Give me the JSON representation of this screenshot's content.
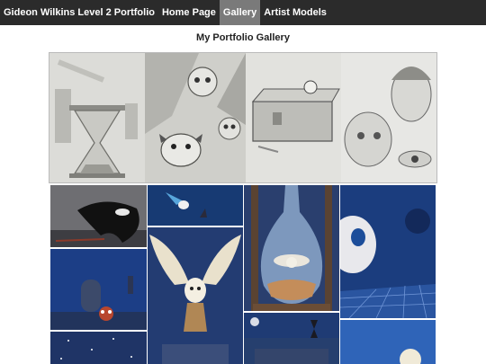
{
  "nav": {
    "brand": "Gideon Wilkins Level 2 Portfolio",
    "items": [
      {
        "label": "Home Page",
        "active": false
      },
      {
        "label": "Gallery",
        "active": true
      },
      {
        "label": "Artist Models",
        "active": false
      }
    ]
  },
  "main": {
    "title": "My Portfolio Gallery"
  },
  "gallery": {
    "images": [
      "graveyard-hourglass-sketch",
      "owls-red-panda-sketch",
      "treasure-chest-watch-sketch",
      "faces-portrait-sketch",
      "orca-painting",
      "night-graveyard-red-panda-painting",
      "starry-night-painting",
      "bluebird-painting",
      "barn-owl-flying-painting",
      "owl-in-glass-hourglass-painting",
      "night-landscape-hourglass-painting",
      "red-panda-blue-grid-painting",
      "blue-sky-owl-painting"
    ]
  },
  "colors": {
    "navbar": "#2b2b2b",
    "nav_active": "#7a7a7a",
    "painting_blue": "#1d3f7a"
  }
}
